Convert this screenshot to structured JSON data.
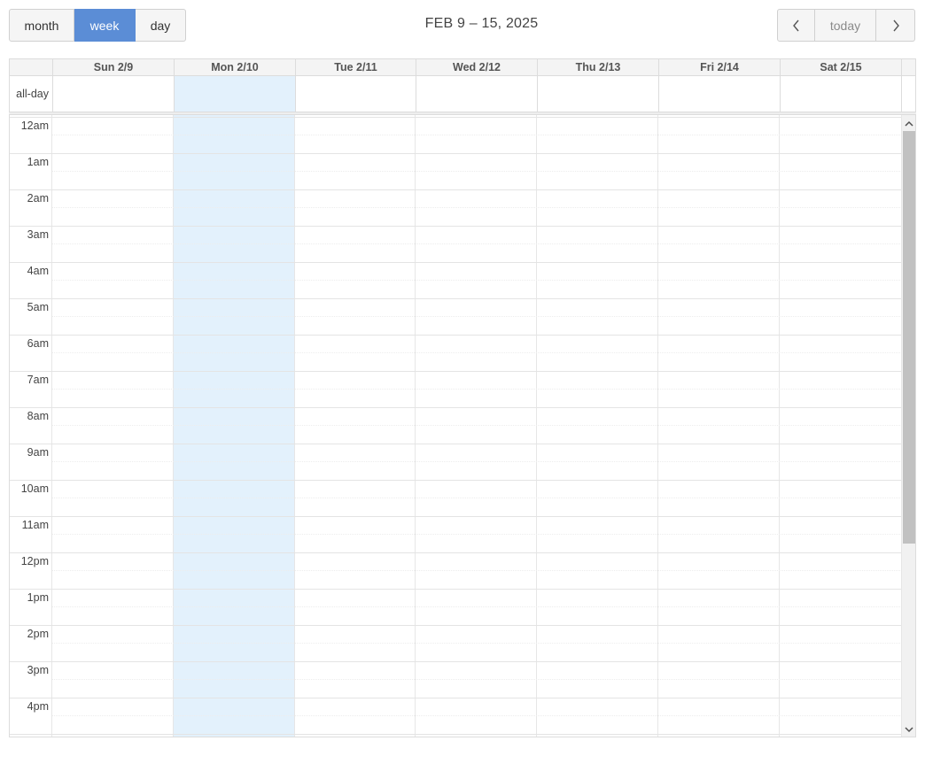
{
  "toolbar": {
    "views": [
      {
        "label": "month",
        "active": false
      },
      {
        "label": "week",
        "active": true
      },
      {
        "label": "day",
        "active": false
      }
    ],
    "title": "FEB 9 – 15, 2025",
    "today_label": "today",
    "prev_icon": "chevron-left-icon",
    "next_icon": "chevron-right-icon"
  },
  "calendar": {
    "allday_label": "all-day",
    "days": [
      {
        "label": "Sun 2/9",
        "today": false
      },
      {
        "label": "Mon 2/10",
        "today": true
      },
      {
        "label": "Tue 2/11",
        "today": false
      },
      {
        "label": "Wed 2/12",
        "today": false
      },
      {
        "label": "Thu 2/13",
        "today": false
      },
      {
        "label": "Fri 2/14",
        "today": false
      },
      {
        "label": "Sat 2/15",
        "today": false
      }
    ],
    "hours": [
      "12am",
      "1am",
      "2am",
      "3am",
      "4am",
      "5am",
      "6am",
      "7am",
      "8am",
      "9am",
      "10am",
      "11am",
      "12pm",
      "1pm",
      "2pm",
      "3pm",
      "4pm"
    ]
  },
  "colors": {
    "active_button": "#5b8dd6",
    "today_highlight": "#e3f1fc",
    "grid_line": "#dcdcdc"
  }
}
